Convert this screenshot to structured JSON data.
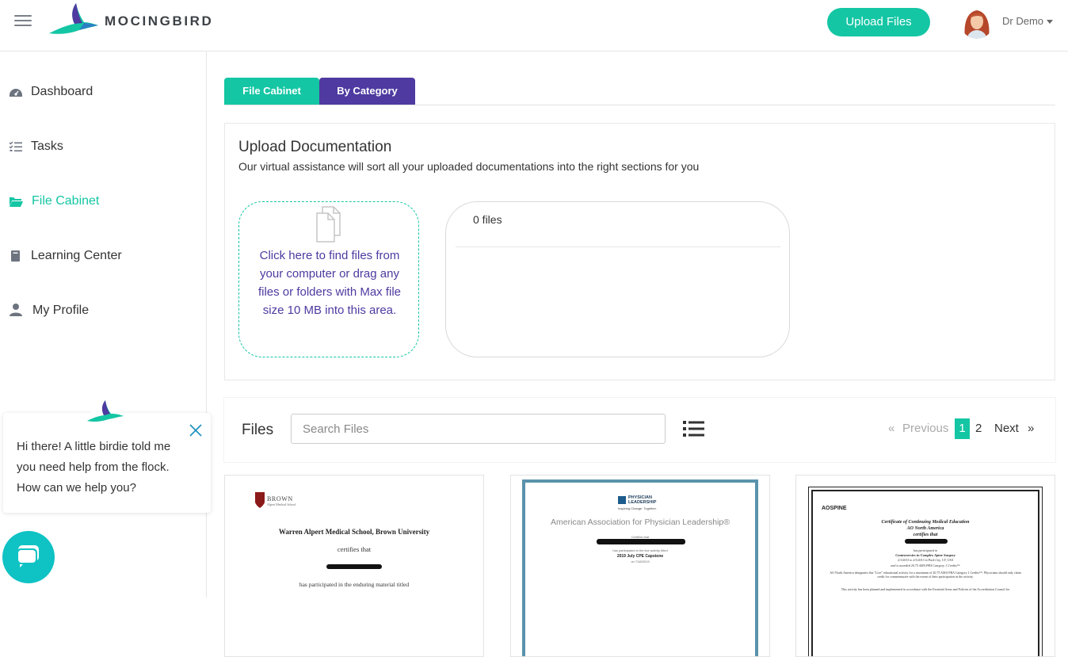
{
  "header": {
    "brand": "MOCINGBIRD",
    "upload_label": "Upload Files",
    "user_name": "Dr Demo"
  },
  "sidebar": {
    "items": [
      {
        "label": "Dashboard",
        "icon": "dashboard-icon"
      },
      {
        "label": "Tasks",
        "icon": "tasks-icon"
      },
      {
        "label": "File Cabinet",
        "icon": "folder-icon",
        "active": true
      },
      {
        "label": "Learning Center",
        "icon": "book-icon"
      },
      {
        "label": "My Profile",
        "icon": "user-icon"
      }
    ]
  },
  "tabs": [
    {
      "label": "File Cabinet"
    },
    {
      "label": "By Category"
    }
  ],
  "upload": {
    "title": "Upload Documentation",
    "subtitle": "Our virtual assistance will sort all your uploaded documentations into the right sections for you",
    "dropzone_text": "Click here to find files from your computer or drag any files or folders with Max file size 10 MB into this area.",
    "file_count": "0 files"
  },
  "files": {
    "label": "Files",
    "search_placeholder": "Search Files",
    "pagination": {
      "prev_symbol": "«",
      "previous": "Previous",
      "pages": [
        "1",
        "2"
      ],
      "next": "Next",
      "next_symbol": "»"
    }
  },
  "certificates": [
    {
      "logo_text": "BROWN",
      "logo_sub": "Alpert Medical School",
      "institution": "Warren Alpert Medical School, Brown University",
      "line1": "certifies that",
      "line2": "has participated in the enduring material titled"
    },
    {
      "logo_text": "PHYSICIAN LEADERSHIP",
      "tagline": "Inspiring Change. Together.",
      "org": "American Association for Physician Leadership®",
      "line1": "Certifies that",
      "line2": "has participated in the live activity titled",
      "course": "2019 July CPE Capstone",
      "date": "on 7/18/2019"
    },
    {
      "logo_text": "AOSPINE",
      "title1": "Certificate of Continuing Medical Education",
      "title2": "AO North America",
      "line1": "certifies that",
      "line2": "has participated in",
      "course": "Controversies in Complex Spine Surgery",
      "dates": "2/1/2013 to 2/3/2013 in Park City, UT, USA",
      "credit": "and is awarded 20.75 AMA PRA Category 1 Credits™",
      "body": "AO North America designates this \"Live\" educational activity for a maximum of 20.75 AMA PRA Category 1 Credits™. Physicians should only claim credit for commensurate with the extent of their participation in the activity.",
      "body2": "This activity has been planned and implemented in accordance with the Essential Areas and Policies of the Accreditation Council for"
    }
  ],
  "chat": {
    "message": "Hi there! A little birdie told me you need help from the flock. How can we help you?"
  },
  "colors": {
    "accent": "#14c6a4",
    "purple": "#4e3aa0",
    "chat": "#0fc2c4"
  }
}
